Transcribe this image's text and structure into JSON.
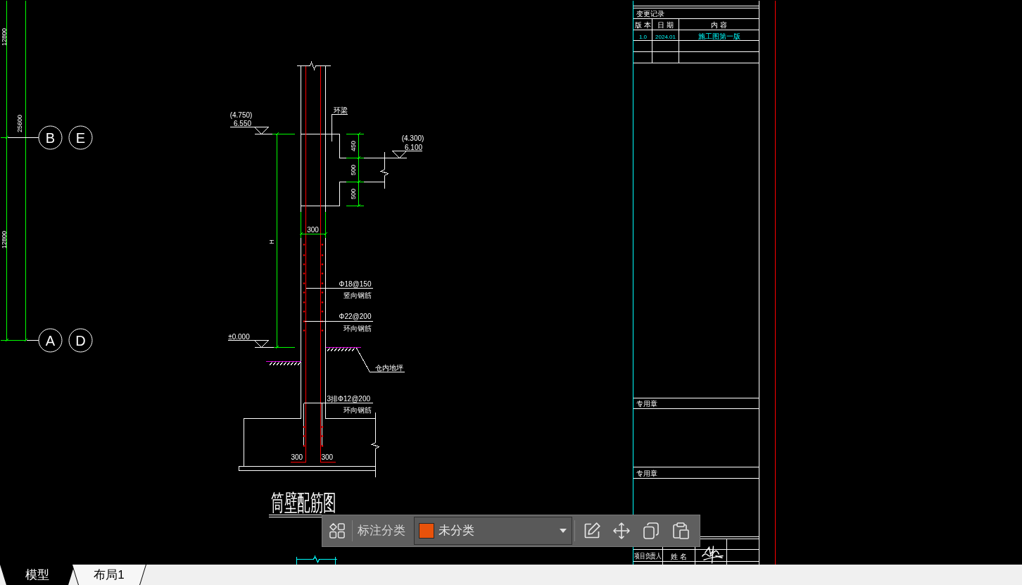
{
  "model_space": {
    "axis_dimensions": [
      "12800",
      "25600",
      "12800"
    ],
    "axis_bubbles": [
      [
        "B",
        "E"
      ],
      [
        "A",
        "D"
      ]
    ],
    "section": {
      "top_elevation": {
        "bracketed": "(4.750)",
        "value": "6.550"
      },
      "ring_beam_label": "环梁",
      "ledge_elevation": {
        "bracketed": "(4.300)",
        "value": "6.100"
      },
      "ledge_dimensions": [
        "450",
        "500",
        "500"
      ],
      "wall_thickness": "300",
      "height_label": "H",
      "rebar_notes": [
        {
          "spec": "Φ18@150",
          "name": "竖向钢筋"
        },
        {
          "spec": "Φ22@200",
          "name": "环向钢筋"
        },
        {
          "spec": "3排Φ12@200",
          "name": "环向钢筋"
        }
      ],
      "ground_elevation": "±0.000",
      "floor_label": "仓内地坪",
      "anchor_lengths": [
        "300",
        "300"
      ],
      "title": "筒壁配筋图"
    },
    "title_block": {
      "revision_title": "变更记录",
      "revision_columns": [
        "版 本",
        "日 期",
        "内 容"
      ],
      "revisions": [
        [
          "1.0",
          "2024.01",
          "施工图第一版"
        ]
      ],
      "stamp_labels": [
        "专用章",
        "专用章"
      ],
      "sign_rows": [
        [
          "项目负责人",
          "姓 名"
        ]
      ]
    }
  },
  "annotation_toolbar": {
    "label": "标注分类",
    "category": {
      "name": "未分类",
      "color": "#e8520a"
    }
  },
  "layout_tabs": [
    {
      "label": "模型",
      "selected": true
    },
    {
      "label": "布局1",
      "selected": false
    }
  ]
}
